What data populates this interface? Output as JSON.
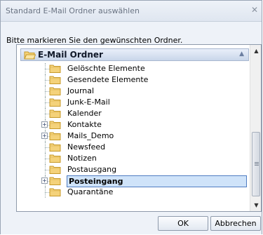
{
  "window": {
    "title": "Standard E-Mail Ordner auswählen"
  },
  "instruction": "Bitte markieren Sie den gewünschten Ordner.",
  "tree": {
    "root_label": "E-Mail Ordner",
    "items": [
      {
        "label": "Gelöschte Elemente",
        "expandable": false,
        "selected": false
      },
      {
        "label": "Gesendete Elemente",
        "expandable": false,
        "selected": false
      },
      {
        "label": "Journal",
        "expandable": false,
        "selected": false
      },
      {
        "label": "Junk-E-Mail",
        "expandable": false,
        "selected": false
      },
      {
        "label": "Kalender",
        "expandable": false,
        "selected": false
      },
      {
        "label": "Kontakte",
        "expandable": true,
        "selected": false
      },
      {
        "label": "Mails_Demo",
        "expandable": true,
        "selected": false
      },
      {
        "label": "Newsfeed",
        "expandable": false,
        "selected": false
      },
      {
        "label": "Notizen",
        "expandable": false,
        "selected": false
      },
      {
        "label": "Postausgang",
        "expandable": false,
        "selected": false
      },
      {
        "label": "Posteingang",
        "expandable": true,
        "selected": true
      },
      {
        "label": "Quarantäne",
        "expandable": false,
        "selected": false
      }
    ]
  },
  "buttons": {
    "ok": "OK",
    "cancel": "Abbrechen"
  },
  "icons": {
    "close": "close-icon",
    "folder": "folder-icon",
    "scroll_up": "scroll-up-icon",
    "scroll_down": "scroll-down-icon",
    "collapse": "chevron-up-icon"
  },
  "colors": {
    "folder_fill": "#f4d27a",
    "folder_stroke": "#c79a2a",
    "selection": "#cfe3f9",
    "selection_border": "#4f7cc2"
  }
}
